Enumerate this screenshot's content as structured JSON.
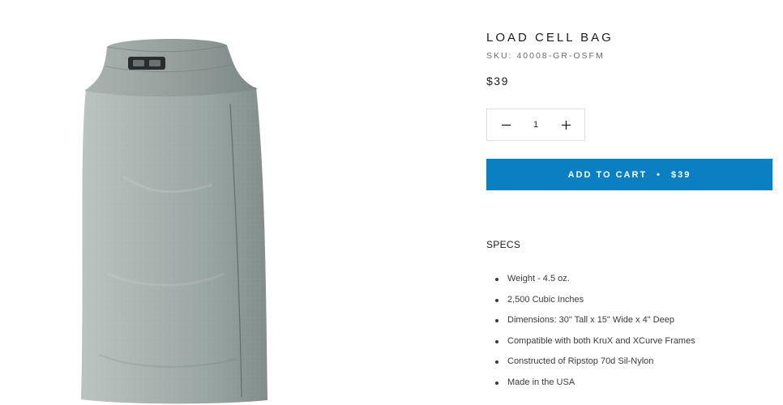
{
  "product": {
    "title": "LOAD CELL BAG",
    "sku": "SKU: 40008-GR-OSFM",
    "price": "$39",
    "image_alt": "gray roll-top dry bag"
  },
  "quantity": {
    "value": "1",
    "decrement_icon": "minus-icon",
    "increment_icon": "plus-icon"
  },
  "cart": {
    "label": "ADD TO CART",
    "separator": "•",
    "price": "$39",
    "color": "#0a7fc2"
  },
  "specs": {
    "heading": "SPECS",
    "items": [
      "Weight - 4.5 oz.",
      "2,500 Cubic Inches",
      "Dimensions: 30\" Tall x 15\" Wide x 4\" Deep",
      "Compatible with both KruX and XCurve Frames",
      "Constructed of Ripstop 70d Sil-Nylon",
      "Made in the USA"
    ]
  },
  "colors": {
    "bag": "#a6b1ae",
    "text": "#1c1b1b"
  }
}
